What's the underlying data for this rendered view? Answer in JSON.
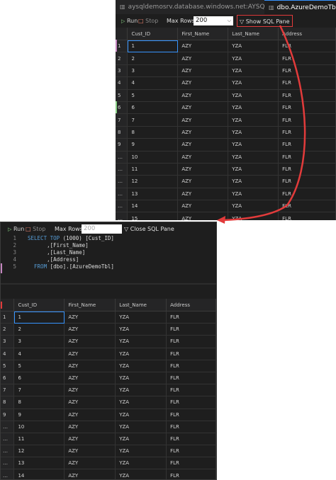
{
  "top_window": {
    "tabs": [
      {
        "label": "aysqldemosrv.database.windows.net:AYSQLDemo"
      },
      {
        "label": "dbo.AzureDemoTbl_1"
      }
    ],
    "toolbar": {
      "run_label": "Run",
      "stop_label": "Stop",
      "max_rows_label": "Max Rows:",
      "max_rows_value": "200",
      "sql_pane_label": "Show SQL Pane"
    }
  },
  "bottom_window": {
    "toolbar": {
      "run_label": "Run",
      "stop_label": "Stop",
      "max_rows_label": "Max Rows:",
      "max_rows_value": "200",
      "sql_pane_label": "Close SQL Pane"
    },
    "sql_lines": [
      {
        "num": "1",
        "kw": "SELECT TOP",
        "text": " (1000) [Cust_ID]"
      },
      {
        "num": "2",
        "kw": "",
        "text": "      ,[First_Name]"
      },
      {
        "num": "3",
        "kw": "",
        "text": "      ,[Last_Name]"
      },
      {
        "num": "4",
        "kw": "",
        "text": "      ,[Address]"
      },
      {
        "num": "5",
        "kw": "  FROM",
        "text": " [dbo].[AzureDemoTbl]"
      }
    ]
  },
  "grid": {
    "columns": [
      "Cust_ID",
      "First_Name",
      "Last_Name",
      "Address"
    ],
    "rows": [
      {
        "h": "1",
        "c": [
          "1",
          "AZY",
          "YZA",
          "FLR"
        ]
      },
      {
        "h": "2",
        "c": [
          "2",
          "AZY",
          "YZA",
          "FLR"
        ]
      },
      {
        "h": "3",
        "c": [
          "3",
          "AZY",
          "YZA",
          "FLR"
        ]
      },
      {
        "h": "4",
        "c": [
          "4",
          "AZY",
          "YZA",
          "FLR"
        ]
      },
      {
        "h": "5",
        "c": [
          "5",
          "AZY",
          "YZA",
          "FLR"
        ]
      },
      {
        "h": "6",
        "c": [
          "6",
          "AZY",
          "YZA",
          "FLR"
        ]
      },
      {
        "h": "7",
        "c": [
          "7",
          "AZY",
          "YZA",
          "FLR"
        ]
      },
      {
        "h": "8",
        "c": [
          "8",
          "AZY",
          "YZA",
          "FLR"
        ]
      },
      {
        "h": "9",
        "c": [
          "9",
          "AZY",
          "YZA",
          "FLR"
        ]
      },
      {
        "h": "…",
        "c": [
          "10",
          "AZY",
          "YZA",
          "FLR"
        ]
      },
      {
        "h": "…",
        "c": [
          "11",
          "AZY",
          "YZA",
          "FLR"
        ]
      },
      {
        "h": "…",
        "c": [
          "12",
          "AZY",
          "YZA",
          "FLR"
        ]
      },
      {
        "h": "…",
        "c": [
          "13",
          "AZY",
          "YZA",
          "FLR"
        ]
      },
      {
        "h": "…",
        "c": [
          "14",
          "AZY",
          "YZA",
          "FLR"
        ]
      },
      {
        "h": "…",
        "c": [
          "15",
          "AZY",
          "YZA",
          "FLR"
        ]
      }
    ]
  },
  "colors": {
    "accent_red": "#e23b3b",
    "run_green": "#89d185",
    "selection_blue": "#3794ff",
    "background": "#1e1e1e"
  }
}
